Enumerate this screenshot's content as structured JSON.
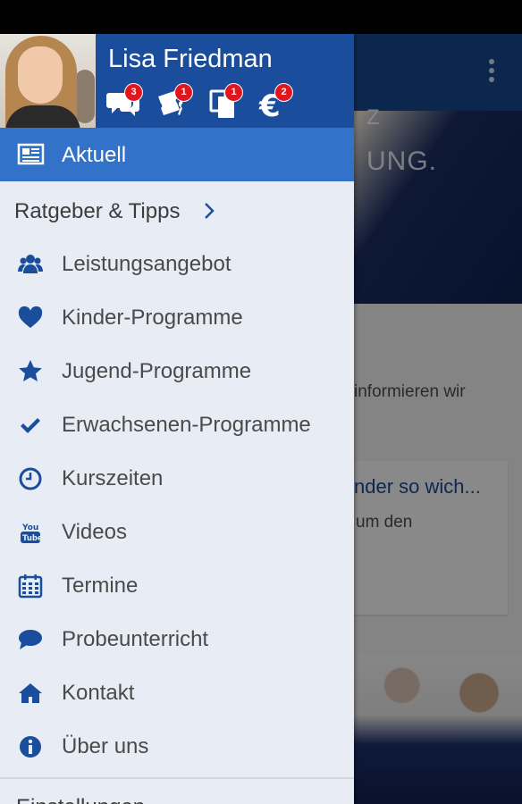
{
  "profile": {
    "name": "Lisa Friedman",
    "badges": [
      {
        "icon": "chat-bubbles-icon",
        "count": "3"
      },
      {
        "icon": "tickets-icon",
        "count": "1"
      },
      {
        "icon": "documents-icon",
        "count": "1"
      },
      {
        "icon": "euro-icon",
        "count": "2"
      }
    ]
  },
  "menu": {
    "active": {
      "label": "Aktuell",
      "icon": "newspaper-icon"
    },
    "section": {
      "label": "Ratgeber & Tipps",
      "icon": "chevron-right-icon"
    },
    "items": [
      {
        "label": "Leistungsangebot",
        "icon": "users-icon"
      },
      {
        "label": "Kinder-Programme",
        "icon": "heart-icon"
      },
      {
        "label": "Jugend-Programme",
        "icon": "star-icon"
      },
      {
        "label": "Erwachsenen-Programme",
        "icon": "checkmark-icon"
      },
      {
        "label": "Kurszeiten",
        "icon": "clock-icon"
      },
      {
        "label": "Videos",
        "icon": "youtube-icon"
      },
      {
        "label": "Termine",
        "icon": "calendar-icon"
      },
      {
        "label": "Probeunterricht",
        "icon": "comment-icon"
      },
      {
        "label": "Kontakt",
        "icon": "home-icon"
      },
      {
        "label": "Über uns",
        "icon": "info-icon"
      }
    ],
    "settings": {
      "label": "Einstellungen"
    }
  },
  "background": {
    "hero_top": "Z",
    "hero_text": "UNG.",
    "body_text": "informieren wir",
    "link_text": "nder so wich...",
    "card_text": "um den"
  },
  "colors": {
    "primary": "#1a4d9c",
    "active_item": "#3272c9",
    "drawer_bg": "#e8edf5",
    "badge": "#e0161f"
  }
}
